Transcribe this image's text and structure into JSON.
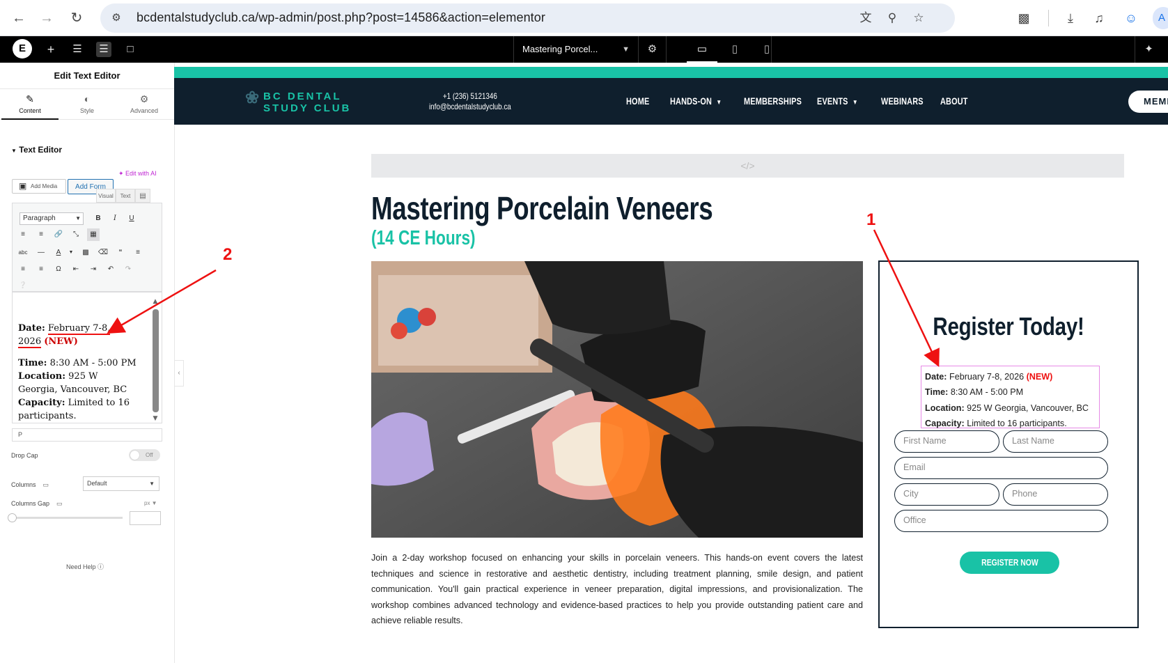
{
  "browser": {
    "url": "bcdentalstudyclub.ca/wp-admin/post.php?post=14586&action=elementor",
    "profile_initial": "A"
  },
  "elementor": {
    "page_selector": "Mastering Porcel...",
    "panel_title": "Edit Text Editor",
    "tabs": [
      "Content",
      "Style",
      "Advanced"
    ],
    "section_title": "Text Editor",
    "edit_with_ai": "Edit with AI",
    "add_media": "Add Media",
    "add_form": "Add Form",
    "editor_tabs": [
      "Visual",
      "Text"
    ],
    "paragraph_select": "Paragraph",
    "editor_content": {
      "date_label": "Date:",
      "date_value": "February 7-8,",
      "date_value_2": "2026",
      "new_tag": "(NEW)",
      "time_label": "Time:",
      "time_value": "8:30 AM - 5:00 PM",
      "location_label": "Location:",
      "location_value": "925 W Georgia, Vancouver, BC",
      "capacity_label": "Capacity:",
      "capacity_value": "Limited to 16 participants."
    },
    "path_bar": "P",
    "drop_cap_label": "Drop Cap",
    "drop_cap_state": "Off",
    "columns_label": "Columns",
    "columns_value": "Default",
    "columns_gap_label": "Columns Gap",
    "columns_gap_unit": "px",
    "need_help": "Need Help"
  },
  "site": {
    "logo_line1": "BC DENTAL",
    "logo_line2": "STUDY CLUB",
    "phone": "+1 (236) 5121346",
    "email": "info@bcdentalstudyclub.ca",
    "nav": [
      "HOME",
      "HANDS-ON",
      "MEMBERSHIPS",
      "EVENTS",
      "WEBINARS",
      "ABOUT"
    ],
    "member_button": "MEMB",
    "accent_color": "#19c2a6",
    "navy_color": "#0f1f2d"
  },
  "content": {
    "code_placeholder": "</>",
    "title": "Mastering Porcelain Veneers",
    "subtitle": "(14 CE Hours)",
    "description": "Join a 2-day workshop focused on enhancing your skills in porcelain veneers. This hands-on event covers the latest techniques and science in restorative and aesthetic dentistry, including treatment planning, smile design, and patient communication. You'll gain practical experience in veneer preparation, digital impressions, and provisionalization. The workshop combines advanced technology and evidence-based practices to help you provide outstanding patient care and achieve reliable results."
  },
  "register": {
    "title": "Register Today!",
    "date_label": "Date:",
    "date_value": "February 7-8, 2026",
    "new_tag": "(NEW)",
    "time_label": "Time:",
    "time_value": "8:30 AM - 5:00 PM",
    "location_label": "Location:",
    "location_value": "925 W Georgia, Vancouver, BC",
    "capacity_label": "Capacity:",
    "capacity_value": "Limited to 16 participants.",
    "fields": {
      "first_name": "First Name",
      "last_name": "Last Name",
      "email": "Email",
      "city": "City",
      "phone": "Phone",
      "office": "Office"
    },
    "button": "REGISTER NOW"
  },
  "annotations": {
    "marker_1": "1",
    "marker_2": "2",
    "color": "#e11111"
  }
}
